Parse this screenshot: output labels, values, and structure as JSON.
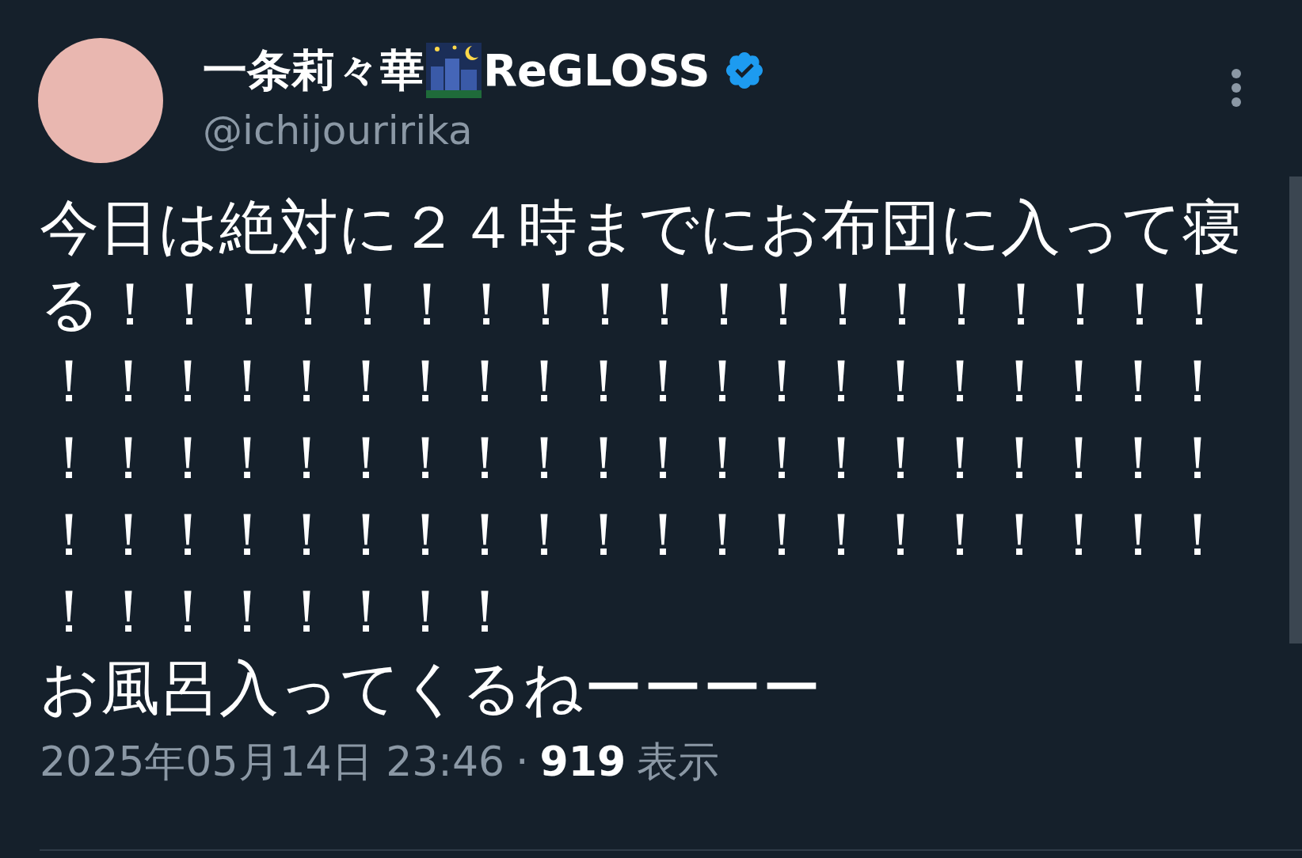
{
  "author": {
    "name": "一条莉々華",
    "name_suffix": "ReGLOSS",
    "verified": true,
    "handle": "@ichijouririka"
  },
  "body": [
    "今日は絶対に２４時までにお布団に入って寝る！！！！！！！！！！！！！！！！！！！！！！！！！！！！！！！！！！！！！！！！！！！！！！！！！！！！！！！！！！！！！！！！！！！！！！！！！！！！！！！！！！！！！！！",
    "お風呂入ってくるねーーーー"
  ],
  "meta": {
    "timestamp": "2025年05月14日 23:46",
    "separator": "·",
    "views_count": "919",
    "views_label": "表示"
  }
}
